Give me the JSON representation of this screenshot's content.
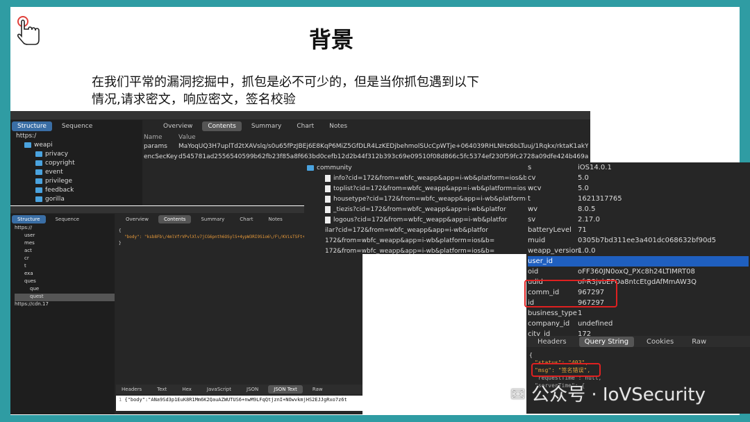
{
  "slide": {
    "title": "背景",
    "description": "在我们平常的漏洞挖掘中，抓包是必不可少的，但是当你抓包遇到以下情况,请求密文，响应密文，签名校验"
  },
  "shot1": {
    "left_tabs": [
      "Structure",
      "Sequence"
    ],
    "tree": [
      "https:/",
      "weapi",
      "privacy",
      "copyright",
      "event",
      "privilege",
      "feedback",
      "gorilla"
    ],
    "tabs": [
      "Overview",
      "Contents",
      "Summary",
      "Chart",
      "Notes"
    ],
    "cols": {
      "name": "Name",
      "value": "Value"
    },
    "rows": [
      {
        "name": "params",
        "value": "MaYoqUQ3H7uplTd2tXAVslq/s0u65fPzJBEj6E8KqP6MiZ5GfDLR4LzKEDjbehmolSUcCpWTje+064039RHLNHz6bLTuuj/1Rqkx/rktaK1akY4bO6..."
      },
      {
        "name": "encSecKey",
        "value": "d545781ad2556540599b62fb23f85a8f663bd0cefb12d2b44f312b393c69e09510f08d866c5fc5374ef230f59fc2728a09dfe424b469aff6e2a5..."
      }
    ]
  },
  "shot2": {
    "left_tabs": [
      "Structure",
      "Sequence"
    ],
    "tree": [
      "https://",
      "user",
      "mes",
      "act",
      "cr",
      "t",
      "exa",
      "ques",
      "que",
      "quest",
      "https://cdn.17"
    ],
    "tabs": [
      "Overview",
      "Contents",
      "Summary",
      "Chart",
      "Notes"
    ],
    "body_prefix": "{",
    "body_key": "\"body\":",
    "body_val": "\"ksb8Fb\\/4mlVfrVPvlXlv7jCG6pnth6OSylS+4ypW3RI9S1o6\\/F\\/KVisTSFt+SAN7\\r\\n+ZINeR9A",
    "body_suffix": "}",
    "bottom_tabs": [
      "Headers",
      "Text",
      "Hex",
      "JavaScript",
      "JSON",
      "JSON Text",
      "Raw"
    ],
    "bottom_line_no": "1",
    "bottom_text": "{\"body\":\"ANa9Sd3p1EuK8R1Mm6K2QauAZWUTUS6+nwM9LFqQtjznI+NOwvkmjHS2EJJgRxo7z6t"
  },
  "shot3": {
    "folder": "community",
    "files": [
      "info?cid=172&from=wbfc_weapp&app=i-wb&platform=ios&b=",
      "toplist?cid=172&from=wbfc_weapp&app=i-wb&platform=ios&b",
      "housetype?cid=172&from=wbfc_weapp&app=i-wb&platform=i",
      "_tiezis?cid=172&from=wbfc_weapp&app=i-wb&platfor",
      "logous?cid=172&from=wbfc_weapp&app=i-wb&platfor",
      "ilar?cid=172&from=wbfc_weapp&app=i-wb&platfor",
      "172&from=wbfc_weapp&app=i-wb&platform=ios&b=",
      "172&from=wbfc_weapp&app=i-wb&platform=ios&b="
    ]
  },
  "shot4": {
    "rows": [
      {
        "k": "s",
        "v": "iOS14.0.1"
      },
      {
        "k": "cv",
        "v": "5.0"
      },
      {
        "k": "wcv",
        "v": "5.0"
      },
      {
        "k": "t",
        "v": "1621317765"
      },
      {
        "k": "wv",
        "v": "8.0.5"
      },
      {
        "k": "sv",
        "v": "2.17.0"
      },
      {
        "k": "batteryLevel",
        "v": "71"
      },
      {
        "k": "muid",
        "v": "0305b7bd311ee3a401dc068632bf90d5"
      },
      {
        "k": "weapp_version",
        "v": "1.0.0"
      },
      {
        "k": "user_id",
        "v": ""
      },
      {
        "k": "oid",
        "v": "oFF360JN0oxQ_PXc8h24LTIMRT08"
      },
      {
        "k": "udid",
        "v": "of-R3jvbEFOa8ntcEtgdAfMmAW3Q"
      },
      {
        "k": "comm_id",
        "v": "967297"
      },
      {
        "k": "id",
        "v": "967297"
      },
      {
        "k": "business_type",
        "v": "1"
      },
      {
        "k": "company_id",
        "v": "undefined"
      },
      {
        "k": "city_id",
        "v": "172"
      }
    ],
    "tabs": [
      "Headers",
      "Query String",
      "Cookies",
      "Raw"
    ],
    "json_open": "{",
    "status_line": "\"status\": \"403\",",
    "msg_line": "\"msg\": \"签名错误\",",
    "req_line": "\"requestTime\": null,",
    "server_line": "\"serverTime\": {"
  },
  "watermark": "公众号 · IoVSecurity"
}
